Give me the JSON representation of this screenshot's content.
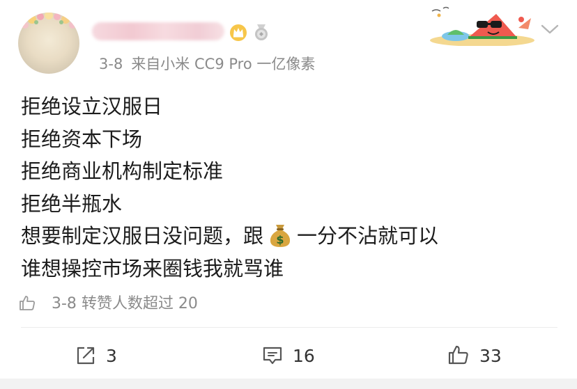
{
  "header": {
    "time": "3-8",
    "source": "来自小米 CC9 Pro 一亿像素"
  },
  "content": {
    "lines": [
      "拒绝设立汉服日",
      "拒绝资本下场",
      "拒绝商业机构制定标准",
      "拒绝半瓶水"
    ],
    "line5_before": "想要制定汉服日没问题，跟",
    "line5_after": "一分不沾就可以",
    "line6": "谁想操控市场来圈钱我就骂谁"
  },
  "repost_info": {
    "time": "3-8",
    "text": "转赞人数超过 20"
  },
  "actions": {
    "repost_count": "3",
    "comment_count": "16",
    "like_count": "33"
  },
  "icons": {
    "avatar": "avatar",
    "crown": "crown-badge-icon",
    "medal": "medal-badge-icon",
    "decor": "watermelon-sunglasses-sticker",
    "chevron": "chevron-down-icon",
    "money": "money-bag-icon",
    "repost": "repost-icon",
    "comment": "comment-icon",
    "like": "thumbs-up-icon"
  },
  "colors": {
    "text": "#1c1c1c",
    "meta": "#8a8a8a",
    "crown": "#f2b233",
    "medal": "#b9b9b9"
  }
}
